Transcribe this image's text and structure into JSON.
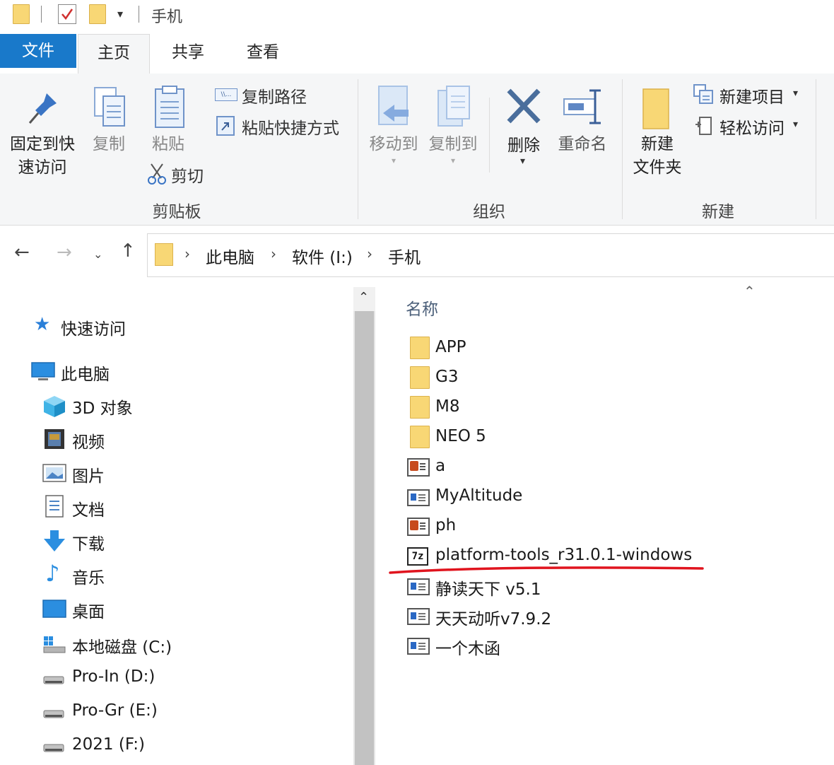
{
  "window": {
    "title": "手机"
  },
  "tabs": {
    "file": "文件",
    "home": "主页",
    "share": "共享",
    "view": "查看"
  },
  "ribbon": {
    "clipboard": {
      "label": "剪贴板",
      "pin_line1": "固定到快",
      "pin_line2": "速访问",
      "copy": "复制",
      "paste": "粘贴",
      "copy_path": "复制路径",
      "paste_shortcut": "粘贴快捷方式",
      "cut": "剪切"
    },
    "organize": {
      "label": "组织",
      "move_to": "移动到",
      "copy_to": "复制到",
      "delete": "删除",
      "rename": "重命名"
    },
    "new": {
      "label": "新建",
      "new_folder_line1": "新建",
      "new_folder_line2": "文件夹",
      "new_item": "新建项目",
      "easy_access": "轻松访问"
    }
  },
  "address": {
    "crumbs": [
      "此电脑",
      "软件 (I:)",
      "手机"
    ]
  },
  "nav": {
    "quick_access": "快速访问",
    "this_pc": "此电脑",
    "items": [
      "3D 对象",
      "视频",
      "图片",
      "文档",
      "下载",
      "音乐",
      "桌面",
      "本地磁盘 (C:)",
      "Pro-In (D:)",
      "Pro-Gr (E:)",
      "2021 (F:)"
    ]
  },
  "filelist": {
    "column_name": "名称",
    "files": [
      "APP",
      "G3",
      "M8",
      "NEO 5",
      "a",
      "MyAltitude",
      "ph",
      "platform-tools_r31.0.1-windows",
      "静读天下 v5.1",
      "天天动听v7.9.2",
      "一个木函"
    ]
  },
  "colors": {
    "accent": "#1979ca",
    "folder": "#f8d775",
    "annotation": "#e0141e"
  }
}
